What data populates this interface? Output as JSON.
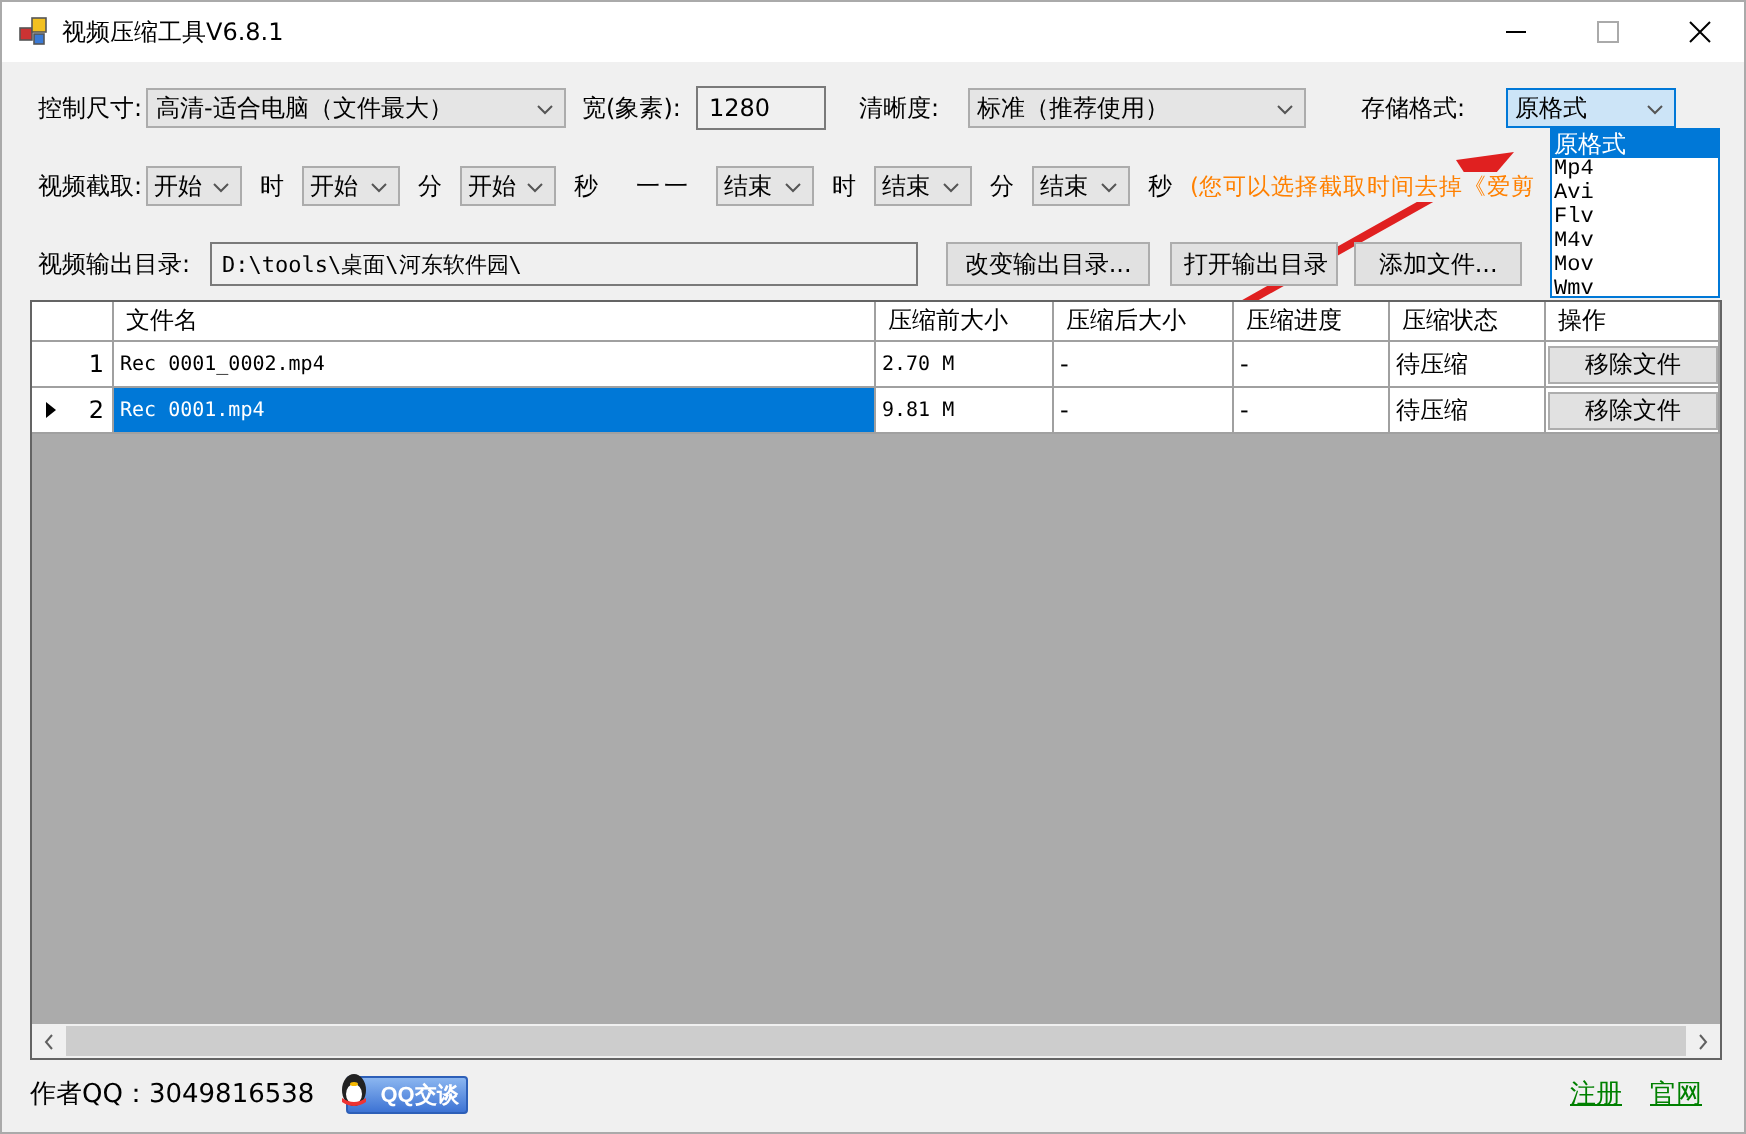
{
  "window": {
    "title": "视频压缩工具V6.8.1"
  },
  "size": {
    "label": "控制尺寸:",
    "value": "高清-适合电脑（文件最大）"
  },
  "width": {
    "label": "宽(象素):",
    "value": "1280"
  },
  "quality": {
    "label": "清晰度:",
    "value": "标准（推荐使用）"
  },
  "format": {
    "label": "存储格式:",
    "value": "原格式",
    "expanded": true,
    "options": [
      {
        "label": "原格式",
        "selected": true
      },
      {
        "label": "Mp4",
        "selected": false
      },
      {
        "label": "Avi",
        "selected": false
      },
      {
        "label": "Flv",
        "selected": false
      },
      {
        "label": "M4v",
        "selected": false
      },
      {
        "label": "Mov",
        "selected": false
      },
      {
        "label": "Wmv",
        "selected": false
      }
    ]
  },
  "clip": {
    "label": "视频截取:",
    "separator": "一一",
    "fields": [
      {
        "value": "开始",
        "unit": "时"
      },
      {
        "value": "开始",
        "unit": "分"
      },
      {
        "value": "开始",
        "unit": "秒"
      },
      {
        "value": "结束",
        "unit": "时"
      },
      {
        "value": "结束",
        "unit": "分"
      },
      {
        "value": "结束",
        "unit": "秒"
      }
    ],
    "hint": "(您可以选择截取时间去掉《爱剪"
  },
  "output": {
    "label": "视频输出目录:",
    "path": "D:\\tools\\桌面\\河东软件园\\"
  },
  "buttons": [
    "改变输出目录...",
    "打开输出目录",
    "添加文件..."
  ],
  "table": {
    "columns": [
      "文件名",
      "压缩前大小",
      "压缩后大小",
      "压缩进度",
      "压缩状态",
      "操作"
    ],
    "rows": [
      {
        "index": "1",
        "current": false,
        "selected": false,
        "cells": [
          "Rec 0001_0002.mp4",
          "2.70 M",
          "-",
          "-",
          "待压缩"
        ],
        "action": "移除文件"
      },
      {
        "index": "2",
        "current": true,
        "selected": true,
        "cells": [
          "Rec 0001.mp4",
          "9.81 M",
          "-",
          "-",
          "待压缩"
        ],
        "action": "移除文件"
      }
    ]
  },
  "footer": {
    "author": "作者QQ：3049816538",
    "qq_button": "QQ交谈",
    "links": [
      "注册",
      "官网"
    ]
  }
}
